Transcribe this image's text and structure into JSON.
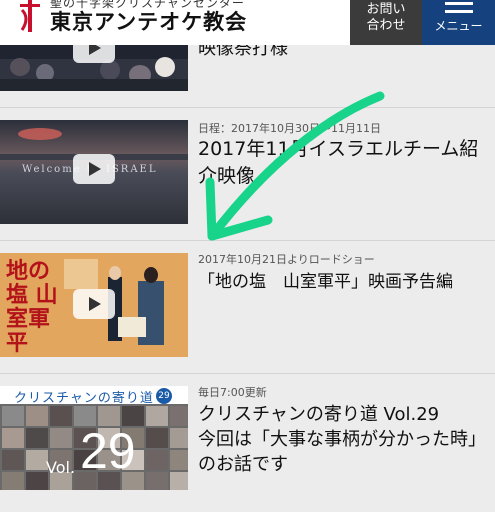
{
  "header": {
    "tagline": "聖の十字架クリスチャンセンター",
    "site_name": "東京アンテオケ教会",
    "contact_line1": "お問い",
    "contact_line2": "合わせ",
    "menu_label": "メニュー"
  },
  "items": [
    {
      "meta": "",
      "title": "映像祭打様"
    },
    {
      "meta": "日程：2017年10月30日〜11月11日",
      "title_line1": "2017年11月イスラエルチーム紹",
      "title_line2": "介映像",
      "thumb_text": "Welcome to ISRAEL"
    },
    {
      "meta": "2017年10月21日よりロードショー",
      "title": "「地の塩　山室軍平」映画予告編",
      "thumb_text": "地の塩 山室軍平"
    },
    {
      "meta": "毎日7:00更新",
      "title_line1": "クリスチャンの寄り道 Vol.29",
      "title_line2": "今回は「大事な事柄が分かった時」",
      "title_line3": "のお話です",
      "thumb_banner": "クリスチャンの寄り道",
      "thumb_badge": "29",
      "thumb_vol_label": "Vol.",
      "thumb_vol_number": "29"
    }
  ],
  "colors": {
    "menu_bg": "#15427e",
    "contact_bg": "#3b3b3b",
    "arrow": "#18d38a"
  }
}
